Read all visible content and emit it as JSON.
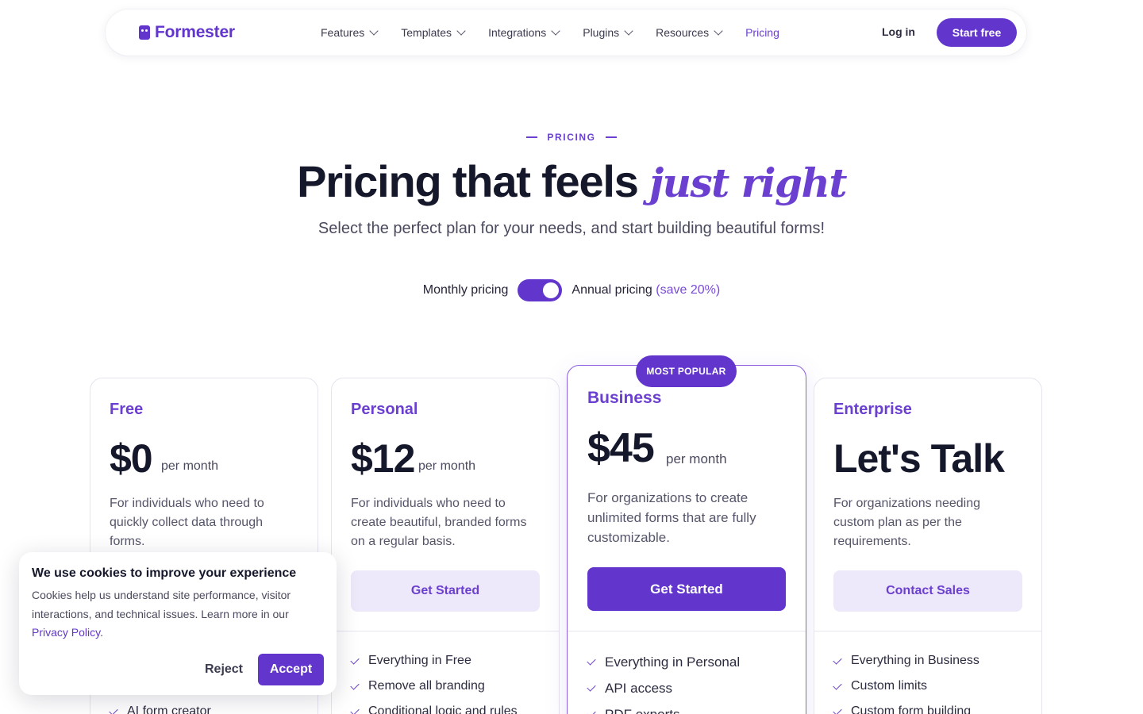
{
  "nav": {
    "logo_text": "Formester",
    "menu": [
      {
        "label": "Features",
        "dropdown": true
      },
      {
        "label": "Templates",
        "dropdown": true
      },
      {
        "label": "Integrations",
        "dropdown": true
      },
      {
        "label": "Plugins",
        "dropdown": true
      },
      {
        "label": "Resources",
        "dropdown": true
      },
      {
        "label": "Pricing",
        "dropdown": false,
        "active": true
      }
    ],
    "login_label": "Log in",
    "cta_label": "Start free"
  },
  "hero": {
    "eyebrow": "PRICING",
    "headline_main": "Pricing that feels ",
    "headline_accent": "just right",
    "subtitle": "Select the perfect plan for your needs, and start building beautiful forms!"
  },
  "billing": {
    "monthly_label": "Monthly pricing",
    "annual_label": "Annual pricing",
    "annual_note": "(save 20%)",
    "annual_selected": true
  },
  "plans": [
    {
      "name": "Free",
      "price": "$0",
      "period": "per month",
      "description": "For individuals who need to quickly collect data through forms.",
      "cta": "Get Started",
      "features": [
        "AI form creator"
      ]
    },
    {
      "name": "Personal",
      "price": "$12",
      "period": "per month",
      "description": "For individuals who need to create beautiful, branded forms on a regular basis.",
      "cta": "Get Started",
      "features": [
        "Everything in Free",
        "Remove all branding",
        "Conditional logic and rules"
      ]
    },
    {
      "name": "Business",
      "badge": "MOST POPULAR",
      "price": "$45",
      "period": "per month",
      "description": "For organizations to create unlimited forms that are fully customizable.",
      "cta": "Get Started",
      "features": [
        "Everything in Personal",
        "API access",
        "PDF exports"
      ]
    },
    {
      "name": "Enterprise",
      "price": "Let's Talk",
      "period": "",
      "description": "For organizations needing custom plan as per the requirements.",
      "cta": "Contact Sales",
      "features": [
        "Everything in Business",
        "Custom limits",
        "Custom form building"
      ]
    }
  ],
  "cookie": {
    "title": "We use cookies to improve your experience",
    "text": "Cookies help us understand site performance, visitor interactions, and technical issues. Learn more in our ",
    "link_text": "Privacy Policy",
    "text_end": ".",
    "reject_label": "Reject",
    "accept_label": "Accept"
  },
  "colors": {
    "brand": "#6236cc",
    "accent_text": "#6b3fd0",
    "cta_soft_bg": "#ede8fa",
    "heading": "#15172b"
  }
}
